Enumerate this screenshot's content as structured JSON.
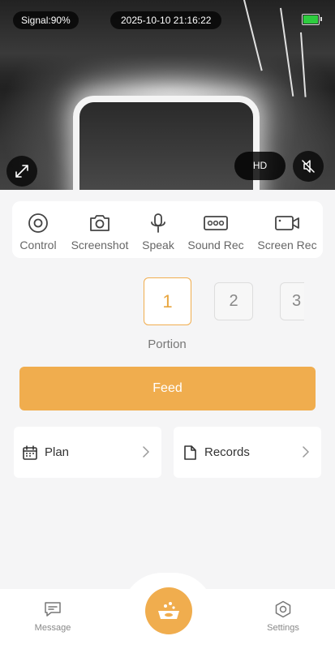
{
  "video": {
    "signal": "Signal:90%",
    "timestamp": "2025-10-10 21:16:22",
    "quality_label": "HD",
    "battery_level": 1.0,
    "battery_color": "#2ecc3f"
  },
  "tools": [
    {
      "label": "Control",
      "icon": "control-icon"
    },
    {
      "label": "Screenshot",
      "icon": "camera-icon"
    },
    {
      "label": "Speak",
      "icon": "microphone-icon"
    },
    {
      "label": "Sound Rec",
      "icon": "sound-record-icon"
    },
    {
      "label": "Screen Rec",
      "icon": "video-camera-icon"
    }
  ],
  "portion": {
    "options": [
      "1",
      "2",
      "3"
    ],
    "selected": "1",
    "label": "Portion"
  },
  "feed": {
    "label": "Feed"
  },
  "cards": {
    "plan": {
      "label": "Plan",
      "icon": "calendar-icon"
    },
    "records": {
      "label": "Records",
      "icon": "document-icon"
    }
  },
  "nav": {
    "message": "Message",
    "settings": "Settings"
  },
  "colors": {
    "accent": "#f0ad4e",
    "background": "#f5f5f6"
  }
}
